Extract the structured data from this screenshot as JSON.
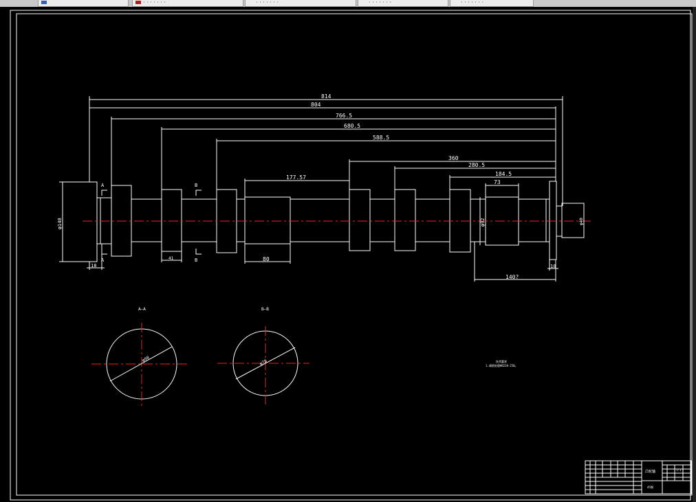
{
  "tabs": [
    {
      "label": ""
    },
    {
      "label": "· · · · · · ·"
    },
    {
      "label": "· · · · · · ·"
    },
    {
      "label": "· · · · · · ·"
    },
    {
      "label": "· · · · · · ·"
    }
  ],
  "colors": {
    "background": "#000000",
    "lines": "#ffffff",
    "centerline": "#ff0000",
    "tab_bar": "#c8c8c8"
  },
  "dimensions": {
    "overall_814": "814",
    "d804": "804",
    "d766_5": "766.5",
    "d680_5": "680.5",
    "d588_5": "588.5",
    "d177_57": "177.57",
    "d360": "360",
    "d280_5": "280.5",
    "d184_5": "184.5",
    "d73": "73",
    "d18_left": "18",
    "d41": "41",
    "d80": "80",
    "d140": "140?",
    "d18_right": "18",
    "dia_left": "φ148",
    "dia_mid": "φ92",
    "dia_right": "φ40"
  },
  "section_marks": {
    "a_top": "A",
    "a_bottom": "A",
    "b_top": "B",
    "b_bottom": "B"
  },
  "sections": {
    "aa_title": "A—A",
    "bb_title": "B—B",
    "aa_dia": "φ98",
    "bb_dia": "φ78"
  },
  "notes": {
    "title": "技术要求",
    "line1": "1.调质处理HB220-250。"
  },
  "title_block": {
    "part_name": "凸轮轴",
    "material": "45钢",
    "scale": "1:1"
  }
}
